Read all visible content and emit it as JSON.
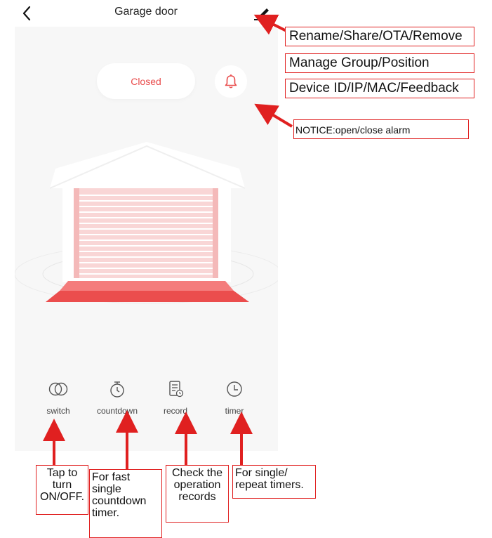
{
  "header": {
    "title": "Garage door",
    "back_icon": "chevron-left-icon",
    "edit_icon": "pencil-icon"
  },
  "status": {
    "label": "Closed",
    "alarm_icon": "bell-icon"
  },
  "colors": {
    "accent": "#e94b4b",
    "annotation": "#e02020",
    "panel_bg": "#f7f7f7"
  },
  "controls": [
    {
      "label": "switch",
      "icon": "switch-circles-icon"
    },
    {
      "label": "countdown",
      "icon": "stopwatch-icon"
    },
    {
      "label": "record",
      "icon": "document-clock-icon"
    },
    {
      "label": "timer",
      "icon": "clock-icon"
    }
  ],
  "annotations": {
    "menu_items": [
      "Rename/Share/OTA/Remove",
      "Manage Group/Position",
      "Device ID/IP/MAC/Feedback"
    ],
    "notice": "NOTICE:open/close alarm",
    "switch_note": [
      "Tap to",
      "turn",
      "ON/OFF."
    ],
    "countdown_note": [
      "For fast",
      "single",
      "countdown",
      "timer."
    ],
    "record_note": [
      "Check the",
      "operation",
      "records"
    ],
    "timer_note": [
      "For single/",
      "repeat timers."
    ]
  }
}
